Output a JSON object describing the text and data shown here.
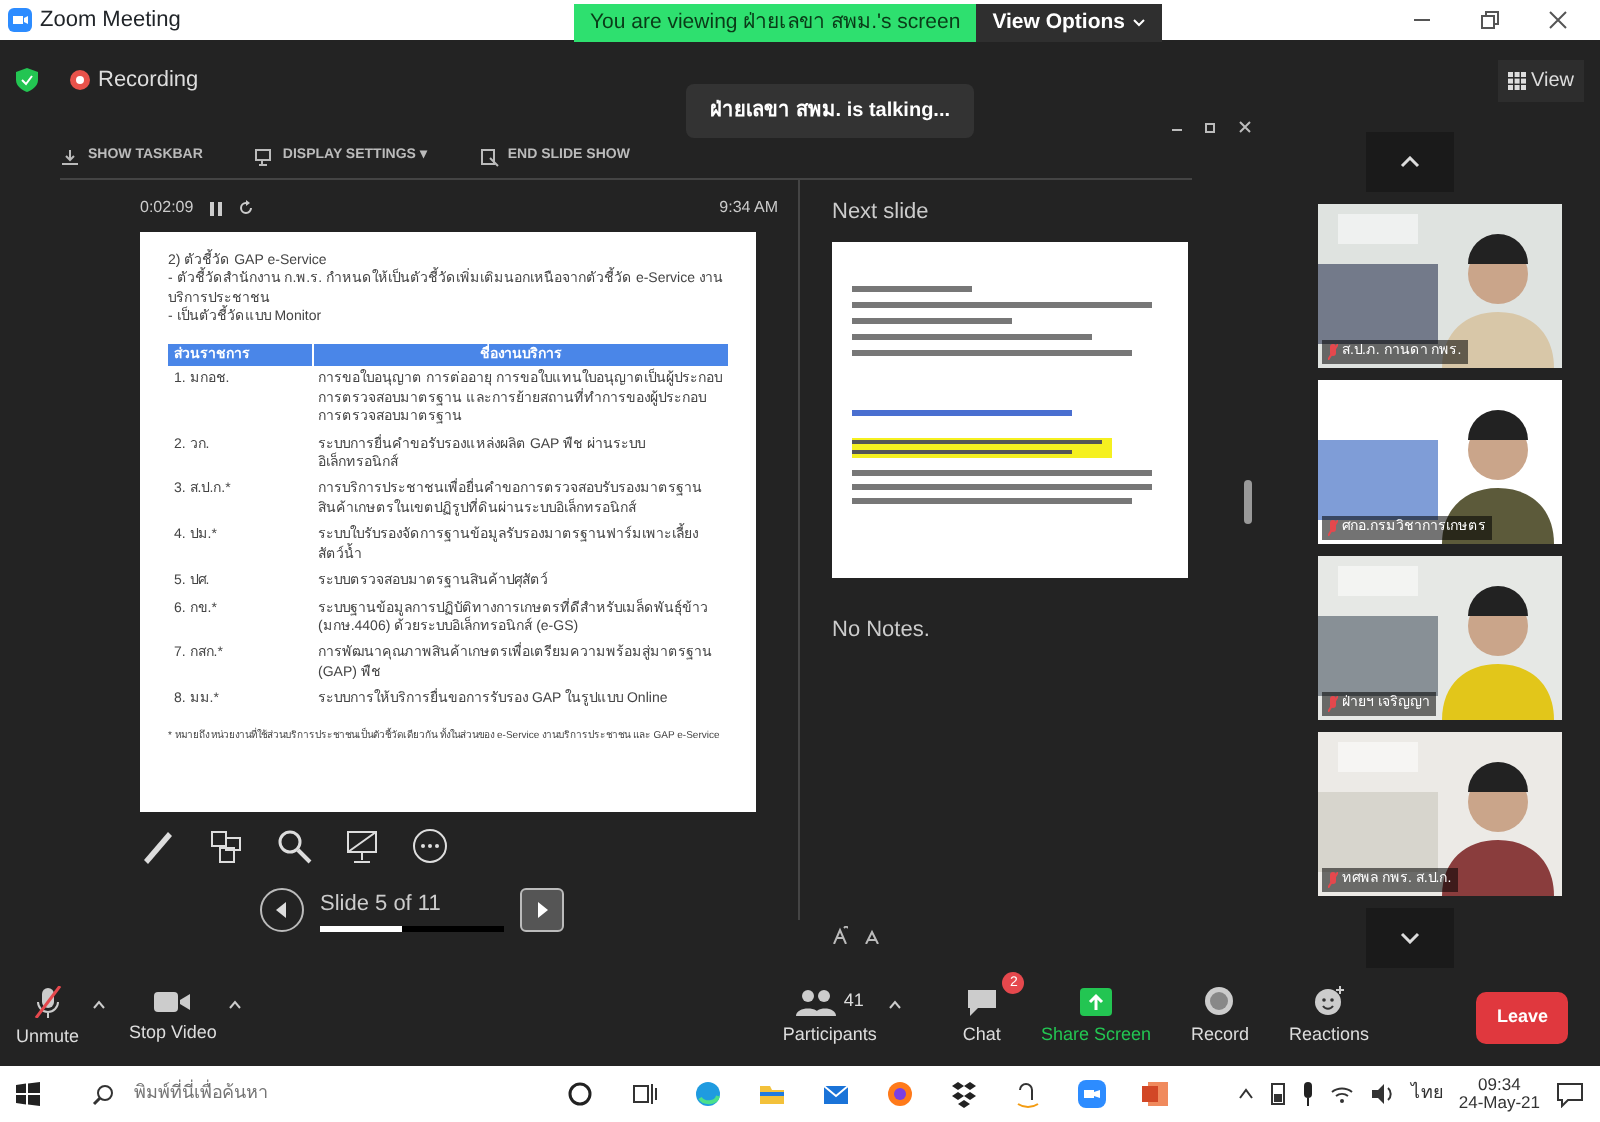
{
  "window": {
    "title": "Zoom Meeting"
  },
  "share_banner": {
    "text": "You are viewing ฝ่ายเลขา สพม.'s screen",
    "view_options": "View Options"
  },
  "recording": {
    "label": "Recording",
    "on": true
  },
  "talking": "ฝ่ายเลขา สพม. is talking...",
  "view_button": "View",
  "presenter": {
    "toolbar": [
      "SHOW TASKBAR",
      "DISPLAY SETTINGS ▾",
      "END SLIDE SHOW"
    ],
    "timer": "0:02:09",
    "clock": "9:34 AM",
    "next_slide_label": "Next slide",
    "notes": "No Notes.",
    "slide_counter": "Slide 5 of 11",
    "level": 0.45
  },
  "slide": {
    "lines": [
      "2) ตัวชี้วัด GAP e-Service",
      "- ตัวชี้วัดสำนักงาน ก.พ.ร. กำหนดให้เป็นตัวชี้วัดเพิ่มเติมนอกเหนือจากตัวชี้วัด e-Service งานบริการประชาชน",
      "- เป็นตัวชี้วัดแบบ Monitor"
    ],
    "table": {
      "columns": [
        "ส่วนราชการ",
        "ชื่องานบริการ"
      ],
      "rows": [
        [
          "1. มกอช.",
          "การขอใบอนุญาต การต่ออายุ การขอใบแทนใบอนุญาตเป็นผู้ประกอบการตรวจสอบมาตรฐาน และการย้ายสถานที่ทำการของผู้ประกอบการตรวจสอบมาตรฐาน"
        ],
        [
          "2. วก.",
          "ระบบการยื่นคำขอรับรองแหล่งผลิต GAP พืช ผ่านระบบอิเล็กทรอนิกส์"
        ],
        [
          "3. ส.ป.ก.*",
          "การบริการประชาชนเพื่อยื่นคำขอการตรวจสอบรับรองมาตรฐานสินค้าเกษตรในเขตปฏิรูปที่ดินผ่านระบบอิเล็กทรอนิกส์"
        ],
        [
          "4. ปม.*",
          "ระบบใบรับรองจัดการฐานข้อมูลรับรองมาตรฐานฟาร์มเพาะเลี้ยงสัตว์น้ำ"
        ],
        [
          "5. ปศ.",
          "ระบบตรวจสอบมาตรฐานสินค้าปศุสัตว์"
        ],
        [
          "6. กข.*",
          "ระบบฐานข้อมูลการปฏิบัติทางการเกษตรที่ดีสำหรับเมล็ดพันธุ์ข้าว (มกษ.4406) ด้วยระบบอิเล็กทรอนิกส์ (e-GS)"
        ],
        [
          "7. กสก.*",
          "การพัฒนาคุณภาพสินค้าเกษตรเพื่อเตรียมความพร้อมสู่มาตรฐาน (GAP) พืช"
        ],
        [
          "8. มม.*",
          "ระบบการให้บริการยื่นขอการรับรอง GAP ในรูปแบบ Online"
        ]
      ]
    },
    "footnote": "* หมายถึง หน่วยงานที่ใช้ส่วนบริการประชาชนเป็นตัวชี้วัดเดียวกัน ทั้งในส่วนของ e-Service งานบริการประชาชน และ GAP e-Service"
  },
  "participants": [
    {
      "name": "ส.ป.ภ. กานดา กพร.",
      "muted": true
    },
    {
      "name": "ศกอ.กรมวิชาการเกษตร",
      "muted": true
    },
    {
      "name": "ฝ่ายฯ เจริญญา",
      "muted": true
    },
    {
      "name": "ทศพล กพร. ส.ป.ก.",
      "muted": true
    }
  ],
  "toolbar": [
    {
      "kind": "mic",
      "label": "Unmute",
      "muted": true
    },
    {
      "kind": "video",
      "label": "Stop Video"
    },
    {
      "kind": "participants",
      "label": "Participants",
      "count": "41"
    },
    {
      "kind": "chat",
      "label": "Chat",
      "badge": "2"
    },
    {
      "kind": "share",
      "label": "Share Screen"
    },
    {
      "kind": "record",
      "label": "Record"
    },
    {
      "kind": "reactions",
      "label": "Reactions"
    }
  ],
  "leave": "Leave",
  "taskbar": {
    "search_placeholder": "พิมพ์ที่นี่เพื่อค้นหา",
    "language": "ไทย",
    "time": "09:34",
    "date": "24-May-21"
  }
}
